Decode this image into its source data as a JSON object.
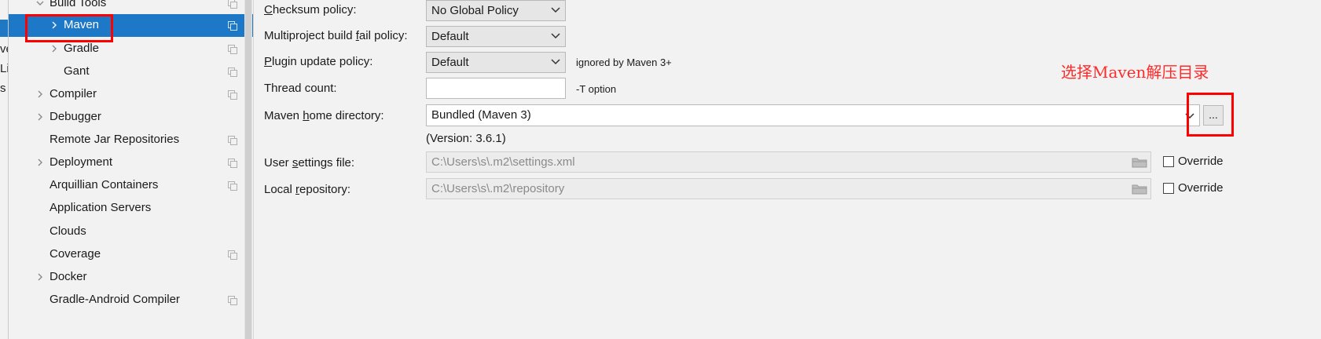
{
  "left_pane_fragments": [
    "ve",
    "Li",
    "s"
  ],
  "tree": {
    "items": [
      {
        "label": "Build Tools",
        "expander": "down",
        "indent": 1,
        "selected": false,
        "project_icon": true
      },
      {
        "label": "Maven",
        "expander": "right",
        "indent": 2,
        "selected": true,
        "project_icon": true
      },
      {
        "label": "Gradle",
        "expander": "right",
        "indent": 2,
        "selected": false,
        "project_icon": true
      },
      {
        "label": "Gant",
        "expander": "none",
        "indent": 2,
        "selected": false,
        "project_icon": true
      },
      {
        "label": "Compiler",
        "expander": "right",
        "indent": 1,
        "selected": false,
        "project_icon": true
      },
      {
        "label": "Debugger",
        "expander": "right",
        "indent": 1,
        "selected": false,
        "project_icon": false
      },
      {
        "label": "Remote Jar Repositories",
        "expander": "none",
        "indent": 1,
        "selected": false,
        "project_icon": true
      },
      {
        "label": "Deployment",
        "expander": "right",
        "indent": 1,
        "selected": false,
        "project_icon": true
      },
      {
        "label": "Arquillian Containers",
        "expander": "none",
        "indent": 1,
        "selected": false,
        "project_icon": true
      },
      {
        "label": "Application Servers",
        "expander": "none",
        "indent": 1,
        "selected": false,
        "project_icon": false
      },
      {
        "label": "Clouds",
        "expander": "none",
        "indent": 1,
        "selected": false,
        "project_icon": false
      },
      {
        "label": "Coverage",
        "expander": "none",
        "indent": 1,
        "selected": false,
        "project_icon": true
      },
      {
        "label": "Docker",
        "expander": "right",
        "indent": 1,
        "selected": false,
        "project_icon": false
      },
      {
        "label": "Gradle-Android Compiler",
        "expander": "none",
        "indent": 1,
        "selected": false,
        "project_icon": true
      }
    ]
  },
  "form": {
    "checksum": {
      "label_pre": "",
      "label_mn": "C",
      "label_post": "hecksum policy:",
      "value": "No Global Policy"
    },
    "multiproject": {
      "label_pre": "Multiproject build ",
      "label_mn": "f",
      "label_post": "ail policy:",
      "value": "Default"
    },
    "plugin": {
      "label_pre": "",
      "label_mn": "P",
      "label_post": "lugin update policy:",
      "value": "Default",
      "note": "ignored by Maven 3+"
    },
    "thread": {
      "label": "Thread count:",
      "value": "",
      "note": "-T option"
    },
    "maven_home": {
      "label_pre": "Maven ",
      "label_mn": "h",
      "label_post": "ome directory:",
      "value": "Bundled (Maven 3)",
      "browse": "...",
      "version": "(Version: 3.6.1)"
    },
    "user_settings": {
      "label_pre": "User ",
      "label_mn": "s",
      "label_post": "ettings file:",
      "value": "C:\\Users\\s\\.m2\\settings.xml",
      "override": "Override"
    },
    "local_repo": {
      "label_pre": "Local ",
      "label_mn": "r",
      "label_post": "epository:",
      "value": "C:\\Users\\s\\.m2\\repository",
      "override": "Override"
    }
  },
  "annotation": {
    "text": "选择Maven解压目录",
    "color": "#ff0000"
  },
  "colors": {
    "selection": "#1e78c8",
    "annotation": "#ff0000",
    "background": "#f2f2f2"
  }
}
